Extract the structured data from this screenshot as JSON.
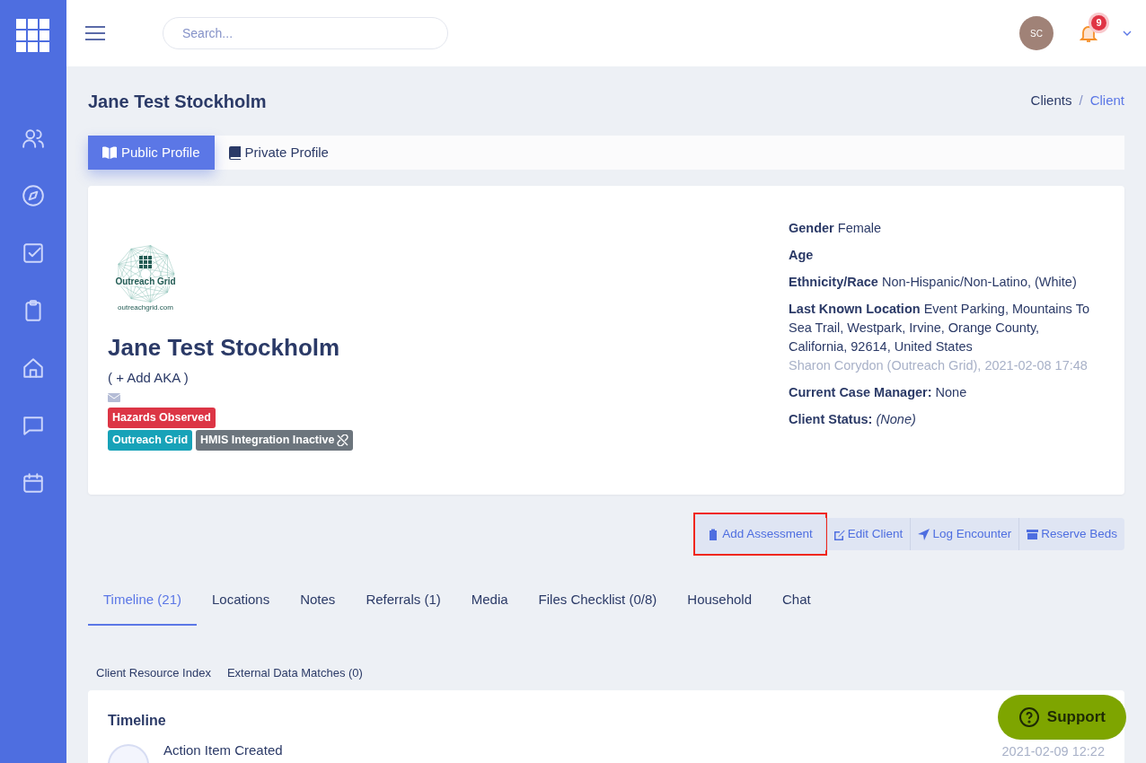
{
  "topbar": {
    "search": {
      "placeholder": "Search..."
    },
    "avatar": "SC",
    "notifications": "9"
  },
  "sidebar": {
    "items": [
      {
        "kind": "users"
      },
      {
        "kind": "compass"
      },
      {
        "kind": "checkbox"
      },
      {
        "kind": "clipboard"
      },
      {
        "kind": "home"
      },
      {
        "kind": "chat"
      },
      {
        "kind": "calendar"
      }
    ]
  },
  "page": {
    "title": "Jane Test Stockholm",
    "breadcrumb_separator": "/",
    "breadcrumb": [
      {
        "label": "Clients",
        "selected": false
      },
      {
        "label": "Client",
        "selected": true
      }
    ]
  },
  "profile_tabs": [
    {
      "label": "Public Profile",
      "selected": true
    },
    {
      "label": "Private Profile",
      "selected": false
    }
  ],
  "profile": {
    "logo": {
      "name": "Outreach Grid",
      "url": "outreachgrid.com"
    },
    "name": "Jane Test Stockholm",
    "aka": "( + Add AKA )",
    "badge_rows": [
      [
        {
          "label": "Hazards Observed",
          "color": "#dc3545",
          "kind": "plain"
        }
      ],
      [
        {
          "label": "Outreach Grid",
          "color": "#17a2b8",
          "kind": "plain"
        },
        {
          "label": "HMIS Integration Inactive",
          "color": "#6c757d",
          "kind": "integration"
        }
      ]
    ],
    "facts": [
      {
        "text": "**Gender** Female"
      },
      {
        "text": "**Age**"
      },
      {
        "text": "**Ethnicity/Race** Non-Hispanic/Non-Latino, (White)"
      },
      {
        "text": "**Last Known Location** Event Parking, Mountains To Sea Trail, Westpark, Irvine, Orange County, California, 92614, United States",
        "note": "Sharon Corydon (Outreach Grid), 2021-02-08 17:48"
      },
      {
        "text": "**Current Case Manager:** None"
      },
      {
        "text": "**Client Status:** *(None)*"
      }
    ]
  },
  "actions": [
    {
      "label": "Add Assessment",
      "highlighted": true
    },
    {
      "label": "Edit Client",
      "highlighted": false
    },
    {
      "label": "Log Encounter",
      "highlighted": false
    },
    {
      "label": "Reserve Beds",
      "highlighted": false
    }
  ],
  "tabs": [
    {
      "label": "Timeline (21)",
      "selected": true
    },
    {
      "label": "Locations",
      "selected": false
    },
    {
      "label": "Notes",
      "selected": false
    },
    {
      "label": "Referrals (1)",
      "selected": false
    },
    {
      "label": "Media",
      "selected": false
    },
    {
      "label": "Files Checklist (0/8)",
      "selected": false
    },
    {
      "label": "Household",
      "selected": false
    },
    {
      "label": "Chat",
      "selected": false
    }
  ],
  "subtabs": [
    "Client Resource Index",
    "External Data Matches (0)"
  ],
  "timeline": {
    "title": "Timeline",
    "items": [
      {
        "title": "Action Item Created",
        "time": "2021-02-09 12:22"
      }
    ]
  },
  "support": {
    "label": "Support"
  }
}
